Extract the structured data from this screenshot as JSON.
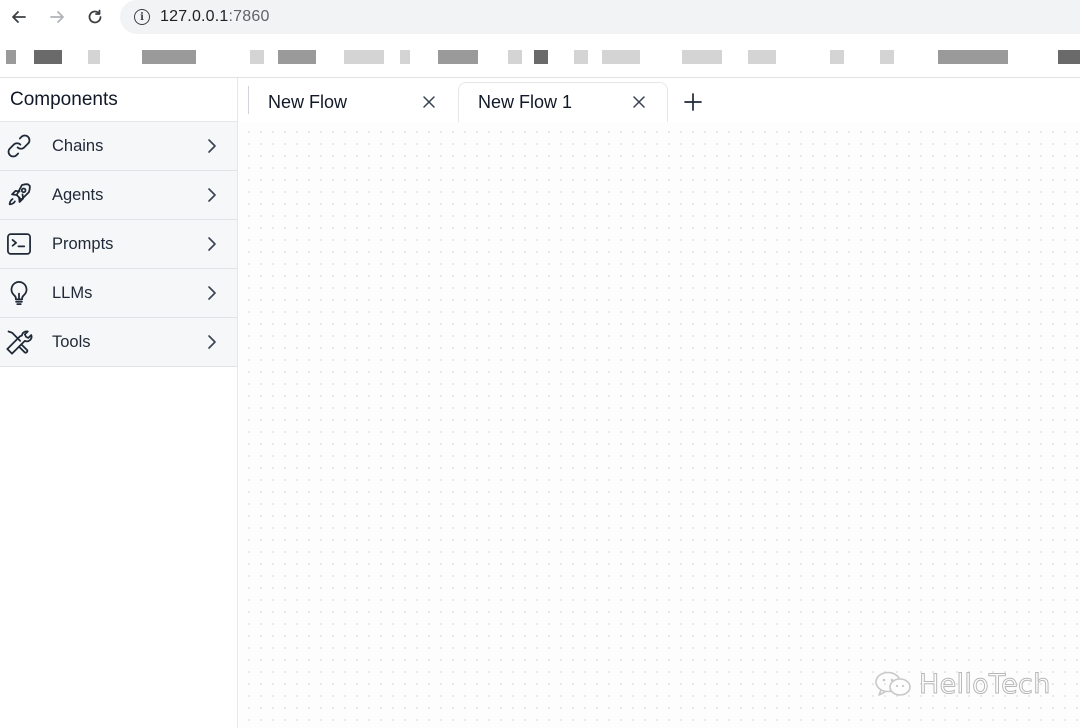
{
  "browser": {
    "url_host": "127.0.0.1",
    "url_port": ":7860",
    "back_icon": "arrow-left-icon",
    "forward_icon": "arrow-right-icon",
    "reload_icon": "reload-icon",
    "info_icon": "info-icon"
  },
  "sidebar": {
    "title": "Components",
    "items": [
      {
        "label": "Chains",
        "icon": "link-icon"
      },
      {
        "label": "Agents",
        "icon": "rocket-icon"
      },
      {
        "label": "Prompts",
        "icon": "terminal-icon"
      },
      {
        "label": "LLMs",
        "icon": "lightbulb-icon"
      },
      {
        "label": "Tools",
        "icon": "wrench-screwdriver-icon"
      }
    ]
  },
  "tabs": {
    "items": [
      {
        "label": "New Flow",
        "active": false
      },
      {
        "label": "New Flow 1",
        "active": true
      }
    ],
    "add_icon": "plus-icon",
    "close_icon": "close-icon"
  },
  "watermark": {
    "text": "HelloTech",
    "icon": "wechat-icon"
  },
  "colors": {
    "sidebar_item_bg": "#f6f7f8",
    "border": "#e5e7eb",
    "canvas_dot": "#e3e3e3"
  }
}
